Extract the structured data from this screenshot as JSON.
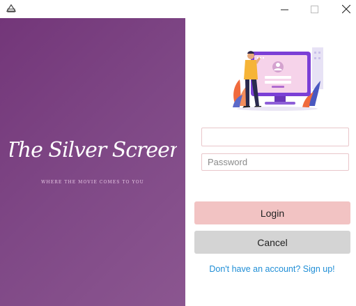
{
  "window": {
    "app_icon": "app-logo-icon",
    "controls": [
      "minimize-icon",
      "maximize-icon",
      "close-icon"
    ]
  },
  "brand": {
    "logo_text": "The Silver Screen",
    "tagline": "WHERE THE MOVIE COMES TO YOU",
    "background_color": "#7a407f"
  },
  "illustration": {
    "icon": "login-illustration-icon"
  },
  "form": {
    "username": {
      "value": "",
      "placeholder": ""
    },
    "password": {
      "value": "",
      "placeholder": "Password"
    },
    "login_label": "Login",
    "cancel_label": "Cancel",
    "signup_link": "Don't have an account? Sign up!"
  },
  "colors": {
    "login_button": "#f2c3c3",
    "cancel_button": "#d4d4d4",
    "link": "#1f8ed6"
  }
}
